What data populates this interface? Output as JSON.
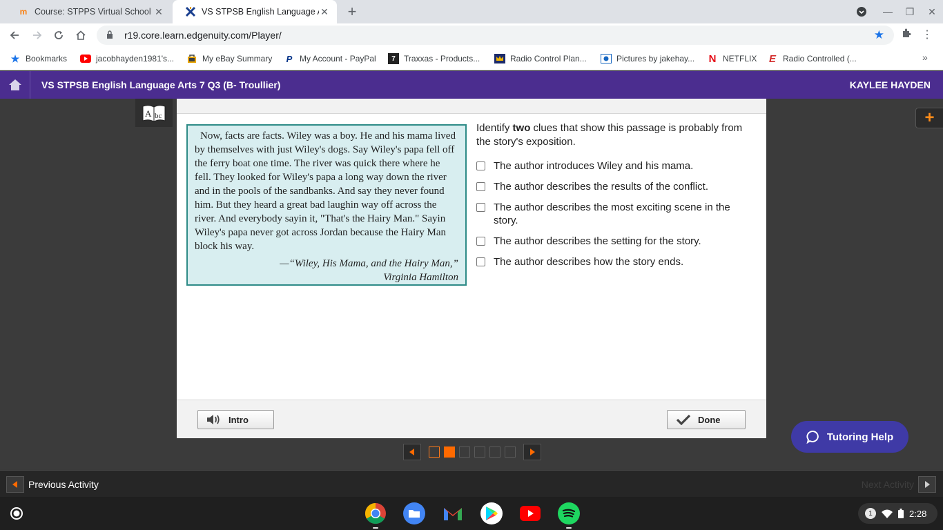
{
  "browser": {
    "tabs": [
      {
        "title": "Course: STPPS Virtual School - C",
        "favicon": "moodle-icon",
        "state": "inactive"
      },
      {
        "title": "VS STPSB English Language Art",
        "favicon": "edgenuity-icon",
        "state": "active"
      }
    ],
    "url": "r19.core.learn.edgenuity.com/Player/",
    "bookmarks": [
      {
        "label": "Bookmarks",
        "icon": "star-icon",
        "color": "#1a73e8"
      },
      {
        "label": "jacobhayden1981's...",
        "icon": "youtube-icon",
        "color": "#ff0000"
      },
      {
        "label": "My eBay Summary",
        "icon": "bag-icon",
        "color": "#3c4043"
      },
      {
        "label": "My Account - PayPal",
        "icon": "paypal-icon",
        "color": "#003087"
      },
      {
        "label": "Traxxas - Products...",
        "icon": "traxxas-icon",
        "color": "#c8102e"
      },
      {
        "label": "Radio Control Plan...",
        "icon": "crown-icon",
        "color": "#b8860b"
      },
      {
        "label": "Pictures by jakehay...",
        "icon": "photo-icon",
        "color": "#1565c0"
      },
      {
        "label": "NETFLIX",
        "icon": "netflix-icon",
        "color": "#e50914"
      },
      {
        "label": "Radio Controlled (...",
        "icon": "e-icon",
        "color": "#d32f2f"
      }
    ]
  },
  "course": {
    "title": "VS STPSB English Language Arts 7 Q3 (B- Troullier)",
    "user": "KAYLEE HAYDEN",
    "header_color": "#4b2d8f"
  },
  "passage": {
    "text": "Now, facts are facts. Wiley was a boy. He and his mama lived by themselves with just Wiley's dogs. Say Wiley's papa fell off the ferry boat one time. The river was quick there where he fell. They looked for Wiley's papa a long way down the river and in the pools of the sandbanks. And say they never found him. But they heard a great bad laughin way off across the river. And everybody sayin it, \"That's the Hairy Man.\" Sayin Wiley's papa never got across Jordan because the Hairy Man block his way.",
    "citation_line1": "—“Wiley, His Mama, and the Hairy Man,”",
    "citation_line2": "Virginia Hamilton"
  },
  "question": {
    "prefix": "Identify ",
    "emphasis": "two",
    "suffix": " clues that show this passage is probably from the story's exposition.",
    "options": [
      {
        "label": "The author introduces Wiley and his mama.",
        "checked": false
      },
      {
        "label": "The author describes the results of the conflict.",
        "checked": false
      },
      {
        "label": "The author describes the most exciting scene in the story.",
        "checked": false
      },
      {
        "label": "The author describes the setting for the story.",
        "checked": false
      },
      {
        "label": "The author describes how the story ends.",
        "checked": false
      }
    ]
  },
  "buttons": {
    "intro": "Intro",
    "done": "Done",
    "tutoring": "Tutoring Help"
  },
  "pager": {
    "total": 6,
    "current": 2,
    "accent": "#ff6a00"
  },
  "activity": {
    "previous": "Previous Activity",
    "next": "Next Activity"
  },
  "system": {
    "time": "2:28",
    "notifications": "1",
    "shelf_apps": [
      "chrome-icon",
      "files-icon",
      "gmail-icon",
      "play-store-icon",
      "youtube-icon",
      "spotify-icon"
    ]
  }
}
